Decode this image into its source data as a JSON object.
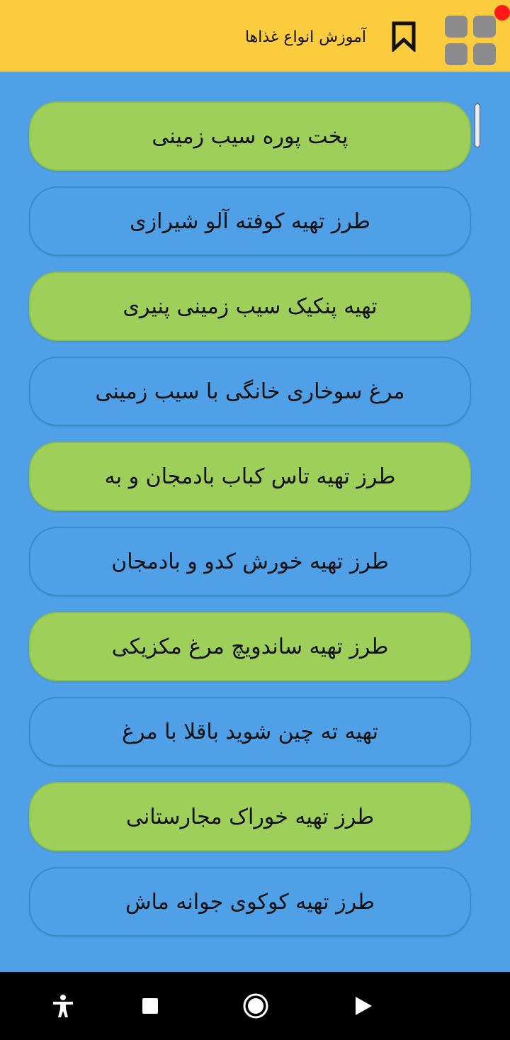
{
  "app_bar": {
    "title": "آموزش انواع غذاها",
    "icons": {
      "menu": "grid-menu-icon",
      "notification": "red-dot",
      "bookmark": "bookmark-icon"
    },
    "colors": {
      "background": "#fccc3f",
      "notification_dot": "#ff1a1a"
    }
  },
  "list": {
    "items": [
      {
        "label": "پخت پوره سیب زمینی",
        "style": "green"
      },
      {
        "label": "طرز تهیه کوفته آلو شیرازی",
        "style": "blue"
      },
      {
        "label": "تهیه پنکیک سیب زمینی پنیری",
        "style": "green"
      },
      {
        "label": "مرغ سوخاری خانگی با سیب زمینی",
        "style": "blue"
      },
      {
        "label": "طرز تهیه تاس کباب بادمجان و به",
        "style": "green"
      },
      {
        "label": "طرز تهیه خورش کدو و بادمجان",
        "style": "blue"
      },
      {
        "label": "طرز تهیه ساندویچ مرغ مکزیکی",
        "style": "green"
      },
      {
        "label": "تهیه ته چین شوید باقلا با مرغ",
        "style": "blue"
      },
      {
        "label": "طرز تهیه خوراک مجارستانی",
        "style": "green"
      },
      {
        "label": "طرز تهیه کوکوی جوانه ماش",
        "style": "blue"
      }
    ],
    "colors": {
      "green": "#9fcf5b",
      "blue": "#4fa0e6"
    }
  },
  "nav_bar": {
    "icons": [
      "accessibility-icon",
      "recents-icon",
      "home-icon",
      "back-icon"
    ]
  }
}
